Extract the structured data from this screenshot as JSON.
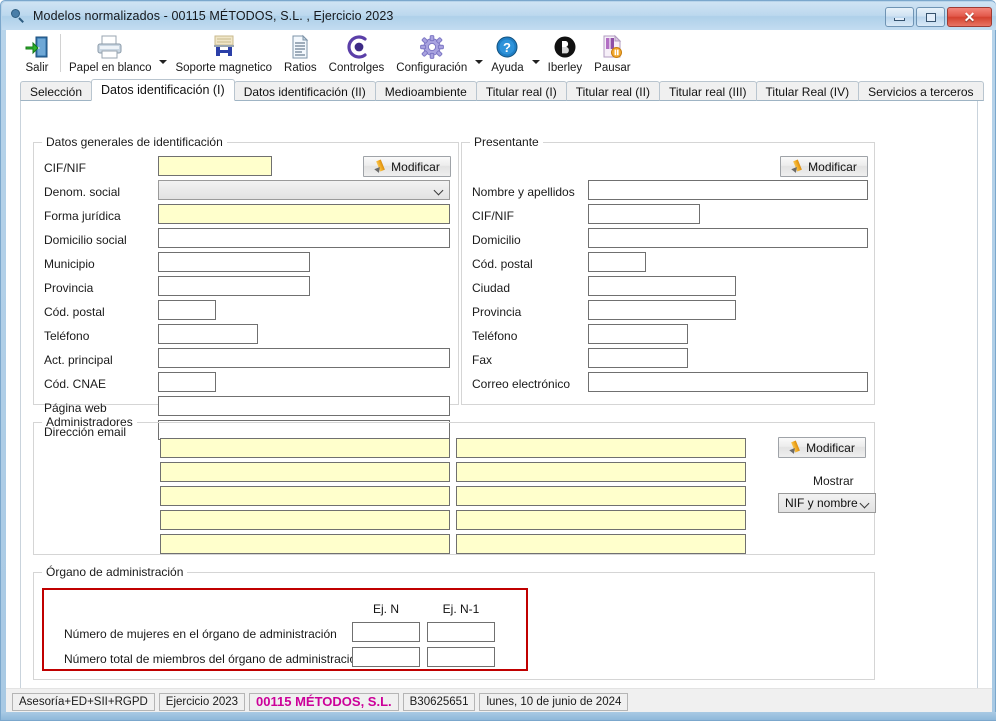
{
  "window": {
    "title": "Modelos normalizados - 00115 MÉTODOS, S.L. , Ejercicio 2023",
    "icon": "magnifier-icon",
    "minimize_label": "",
    "maximize_label": "",
    "close_label": "✕"
  },
  "toolbar": {
    "items": [
      {
        "label": "Salir",
        "icon": "exit-door-icon",
        "has_caret": false
      },
      {
        "label": "Papel en blanco",
        "icon": "printer-icon",
        "has_caret": true
      },
      {
        "label": "Soporte magnetico",
        "icon": "magnetic-support-icon",
        "has_caret": false
      },
      {
        "label": "Ratios",
        "icon": "document-lines-icon",
        "has_caret": false
      },
      {
        "label": "Controlges",
        "icon": "controlges-eye-icon",
        "has_caret": false
      },
      {
        "label": "Configuración",
        "icon": "gear-icon",
        "has_caret": true
      },
      {
        "label": "Ayuda",
        "icon": "help-question-icon",
        "has_caret": true
      },
      {
        "label": "Iberley",
        "icon": "iberley-circle-icon",
        "has_caret": false
      },
      {
        "label": "Pausar",
        "icon": "pause-page-icon",
        "has_caret": false
      }
    ]
  },
  "tabs": [
    {
      "label": "Selección",
      "active": false
    },
    {
      "label": "Datos identificación (I)",
      "active": true
    },
    {
      "label": "Datos identificación (II)",
      "active": false
    },
    {
      "label": "Medioambiente",
      "active": false
    },
    {
      "label": "Titular real (I)",
      "active": false
    },
    {
      "label": "Titular real (II)",
      "active": false
    },
    {
      "label": "Titular real (III)",
      "active": false
    },
    {
      "label": "Titular Real (IV)",
      "active": false
    },
    {
      "label": "Servicios a terceros",
      "active": false
    }
  ],
  "datos_generales": {
    "legend": "Datos generales de identificación",
    "modify_button": "Modificar",
    "fields": [
      {
        "label": "CIF/NIF",
        "value": "",
        "style": "yellow"
      },
      {
        "label": "Denom. social",
        "value": "",
        "style": "combo"
      },
      {
        "label": "Forma jurídica",
        "value": "",
        "style": "yellow"
      },
      {
        "label": "Domicilio social",
        "value": "",
        "style": "plain"
      },
      {
        "label": "Municipio",
        "value": "",
        "style": "plain"
      },
      {
        "label": "Provincia",
        "value": "",
        "style": "plain"
      },
      {
        "label": "Cód. postal",
        "value": "",
        "style": "plain"
      },
      {
        "label": "Teléfono",
        "value": "",
        "style": "plain"
      },
      {
        "label": "Act. principal",
        "value": "",
        "style": "plain"
      },
      {
        "label": "Cód. CNAE",
        "value": "",
        "style": "plain"
      },
      {
        "label": "Página web",
        "value": "",
        "style": "plain"
      },
      {
        "label": "Dirección email",
        "value": "",
        "style": "plain"
      }
    ]
  },
  "presentante": {
    "legend": "Presentante",
    "modify_button": "Modificar",
    "fields": [
      {
        "label": "Nombre y apellidos",
        "value": ""
      },
      {
        "label": "CIF/NIF",
        "value": ""
      },
      {
        "label": "Domicilio",
        "value": ""
      },
      {
        "label": "Cód. postal",
        "value": ""
      },
      {
        "label": "Ciudad",
        "value": ""
      },
      {
        "label": "Provincia",
        "value": ""
      },
      {
        "label": "Teléfono",
        "value": ""
      },
      {
        "label": "Fax",
        "value": ""
      },
      {
        "label": "Correo electrónico",
        "value": ""
      }
    ]
  },
  "administradores": {
    "legend": "Administradores",
    "modify_button": "Modificar",
    "mostrar_label": "Mostrar",
    "mostrar_value": "NIF y nombre",
    "rows": [
      {
        "nif": "",
        "nombre": ""
      },
      {
        "nif": "",
        "nombre": ""
      },
      {
        "nif": "",
        "nombre": ""
      },
      {
        "nif": "",
        "nombre": ""
      },
      {
        "nif": "",
        "nombre": ""
      }
    ]
  },
  "organo_administracion": {
    "legend": "Órgano de administración",
    "col_headers": [
      "Ej. N",
      "Ej. N-1"
    ],
    "rows": [
      {
        "label": "Número de mujeres en el órgano de administración",
        "ej_n": "",
        "ej_n1": ""
      },
      {
        "label": "Número total de miembros del órgano de administración",
        "ej_n": "",
        "ej_n1": ""
      }
    ],
    "highlight_color": "#c00000"
  },
  "statusbar": {
    "cells": [
      {
        "text": "Asesoría+ED+SII+RGPD",
        "style": "normal"
      },
      {
        "text": "Ejercicio 2023",
        "style": "normal"
      },
      {
        "text": "00115 MÉTODOS, S.L.",
        "style": "company"
      },
      {
        "text": "B30625651",
        "style": "normal"
      },
      {
        "text": "lunes, 10 de junio de 2024",
        "style": "normal"
      }
    ]
  },
  "colors": {
    "required_field": "#ffffcc",
    "company_text": "#cc0099",
    "highlight_border": "#c00000",
    "titlebar": "#bcd8ee"
  }
}
